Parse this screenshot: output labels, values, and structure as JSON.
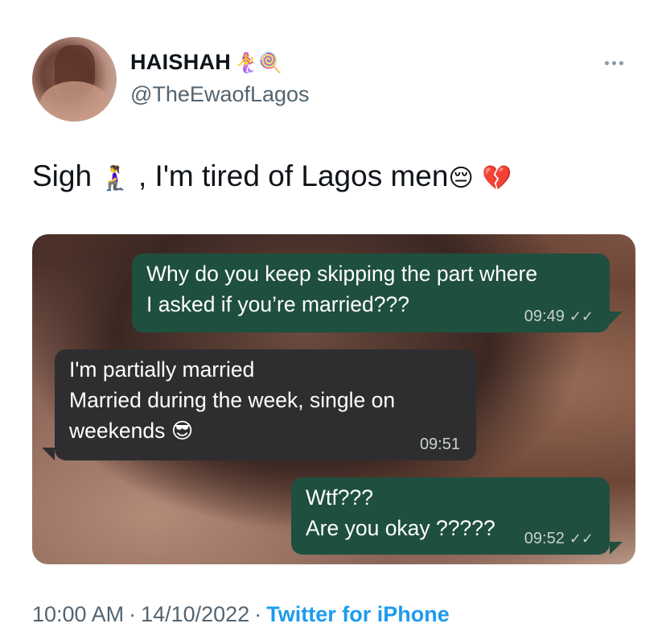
{
  "author": {
    "display_name": "HAISHAH",
    "name_emojis": "🧜‍♀️🍭",
    "handle": "@TheEwaofLagos",
    "avatar_icon": "profile-photo"
  },
  "tweet": {
    "text_part1": "Sigh",
    "emoji1": "🧎‍♀️",
    "text_part2": ", I'm tired of Lagos men",
    "emoji2": "😔",
    "emoji3": "💔"
  },
  "chat": {
    "messages": [
      {
        "direction": "outgoing",
        "text_lines": [
          "Why do you keep skipping the part where",
          "I asked if you’re married???"
        ],
        "time": "09:49",
        "ticks": "✓✓"
      },
      {
        "direction": "incoming",
        "text_lines": [
          "I'm partially married",
          "Married during the week, single on",
          "weekends 😎"
        ],
        "time": "09:51"
      },
      {
        "direction": "outgoing",
        "text_lines": [
          "Wtf???",
          "Are you okay ?????"
        ],
        "time": "09:52",
        "ticks": "✓✓"
      }
    ]
  },
  "meta": {
    "time": "10:00 AM",
    "separator": "·",
    "date": "14/10/2022",
    "source": "Twitter for iPhone"
  },
  "colors": {
    "link": "#1d9bf0",
    "outgoing_bubble": "#1f4f3f",
    "incoming_bubble": "#2e2e30"
  }
}
